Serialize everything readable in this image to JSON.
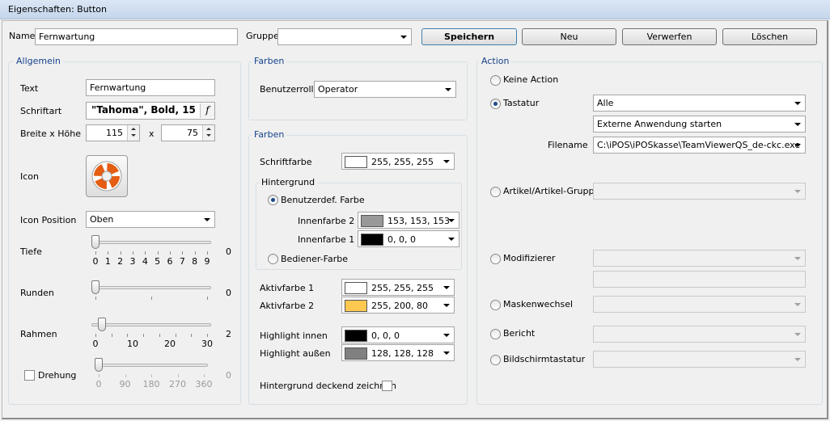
{
  "window": {
    "title": "Eigenschaften: Button"
  },
  "topbar": {
    "name_label": "Name",
    "name_value": "Fernwartung",
    "gruppe_label": "Gruppe",
    "gruppe_value": "",
    "speichern": "Speichern",
    "neu": "Neu",
    "verwerfen": "Verwerfen",
    "loeschen": "Löschen"
  },
  "allgemein": {
    "title": "Allgemein",
    "text_label": "Text",
    "text_value": "Fernwartung",
    "schriftart_label": "Schriftart",
    "schriftart_value": "\"Tahoma\", Bold, 15",
    "font_button_glyph": "f",
    "breite_label": "Breite x Höhe",
    "breite_value": "115",
    "x_label": "x",
    "hoehe_value": "75",
    "icon_label": "Icon",
    "icon_name": "lifebuoy-icon",
    "iconpos_label": "Icon Position",
    "iconpos_value": "Oben",
    "tiefe": {
      "label": "Tiefe",
      "value": "0",
      "min": 0,
      "max": 9,
      "ticks": [
        "0",
        "1",
        "2",
        "3",
        "4",
        "5",
        "6",
        "7",
        "8",
        "9"
      ]
    },
    "runden": {
      "label": "Runden",
      "value": "0",
      "min": 0,
      "max": 50
    },
    "rahmen": {
      "label": "Rahmen",
      "value": "2",
      "min": 0,
      "max": 35,
      "ticks": [
        "0",
        "10",
        "20",
        "30"
      ]
    },
    "drehung": {
      "label": "Drehung",
      "value": "0",
      "min": 0,
      "max": 360,
      "ticks": [
        "0",
        "90",
        "180",
        "270",
        "360"
      ],
      "checked": false
    }
  },
  "farben1": {
    "title": "Farben",
    "rolle_label": "Benutzerrolle",
    "rolle_value": "Operator"
  },
  "farben2": {
    "title": "Farben",
    "schriftfarbe_label": "Schriftfarbe",
    "schriftfarbe": {
      "text": "255, 255, 255",
      "hex": "#ffffff"
    },
    "hintergrund_title": "Hintergrund",
    "benutzerdef_label": "Benutzerdef. Farbe",
    "innen2_label": "Innenfarbe 2",
    "innen2": {
      "text": "153, 153, 153",
      "hex": "#999999"
    },
    "innen1_label": "Innenfarbe 1",
    "innen1": {
      "text": "0, 0, 0",
      "hex": "#000000"
    },
    "bediener_label": "Bediener-Farbe",
    "aktiv1_label": "Aktivfarbe 1",
    "aktiv1": {
      "text": "255, 255, 255",
      "hex": "#ffffff"
    },
    "aktiv2_label": "Aktivfarbe 2",
    "aktiv2": {
      "text": "255, 200, 80",
      "hex": "#ffc850"
    },
    "hl_innen_label": "Highlight innen",
    "hl_innen": {
      "text": "0, 0, 0",
      "hex": "#000000"
    },
    "hl_aussen_label": "Highlight außen",
    "hl_aussen": {
      "text": "128, 128, 128",
      "hex": "#808080"
    },
    "deckend_label": "Hintergrund deckend zeichnen"
  },
  "action": {
    "title": "Action",
    "keine_label": "Keine Action",
    "tastatur_label": "Tastatur",
    "tastatur_value": "Alle",
    "anwendung_value": "Externe Anwendung starten",
    "filename_label": "Filename",
    "filename_value": "C:\\iPOS\\iPOSkasse\\TeamViewerQS_de-ckc.exe",
    "artikel_label": "Artikel/Artikel-Gruppe",
    "modifizierer_label": "Modifizierer",
    "maskenwechsel_label": "Maskenwechsel",
    "bericht_label": "Bericht",
    "bildschirm_label": "Bildschirmtastatur"
  }
}
